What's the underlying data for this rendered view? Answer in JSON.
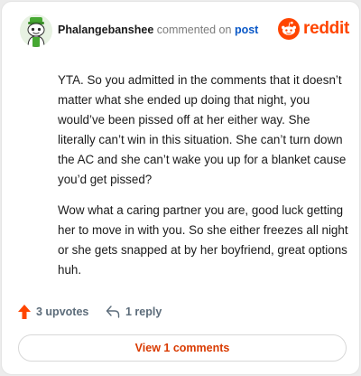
{
  "header": {
    "username": "Phalangebanshee",
    "action_text": "commented on",
    "target_link": "post",
    "brand_name": "reddit"
  },
  "comment": {
    "paragraphs": [
      "YTA. So you admitted in the comments that it doesn’t matter what she ended up doing that night, you would’ve been pissed off at her either way. She literally can’t win in this situation. She can’t turn down the AC and she can’t wake you up for a blanket cause you’d get pissed?",
      "Wow what a caring partner you are, good luck getting her to move in with you. So she either freezes all night or she gets snapped at by her boyfriend, great options huh."
    ]
  },
  "actions": {
    "upvotes_label": "3 upvotes",
    "reply_label": "1 reply"
  },
  "footer": {
    "view_button": "View 1 comments"
  },
  "icons": {
    "avatar": "snoo-avatar-icon",
    "brand": "reddit-logo-icon",
    "upvote": "upvote-arrow-icon",
    "reply": "reply-arrow-icon"
  },
  "colors": {
    "accent": "#ff4500",
    "link": "#0a58c7",
    "action_text": "#5c6c7a",
    "view_button_text": "#d93a00"
  }
}
